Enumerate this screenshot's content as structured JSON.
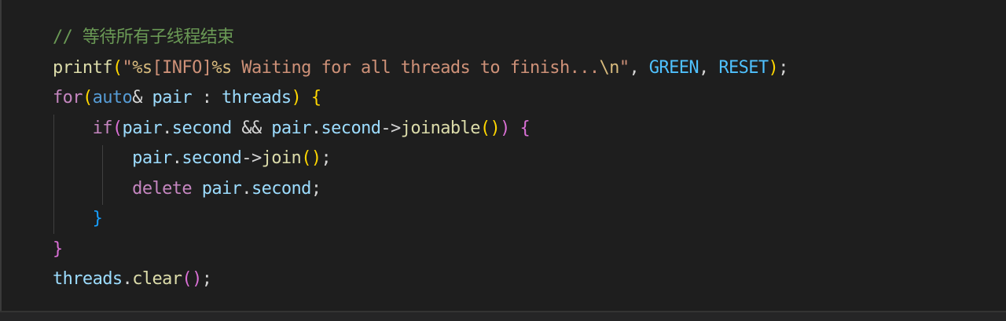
{
  "editor": {
    "lines": [
      {
        "indent": 0,
        "tokens": [
          {
            "t": "// 等待所有子线程结束",
            "c": "t-comment"
          }
        ]
      },
      {
        "indent": 0,
        "tokens": [
          {
            "t": "printf",
            "c": "t-func"
          },
          {
            "t": "(",
            "c": "t-brace1"
          },
          {
            "t": "\"",
            "c": "t-string"
          },
          {
            "t": "%s",
            "c": "t-escape"
          },
          {
            "t": "[INFO]",
            "c": "t-string"
          },
          {
            "t": "%s",
            "c": "t-escape"
          },
          {
            "t": " Waiting for all threads to finish...",
            "c": "t-string"
          },
          {
            "t": "\\n",
            "c": "t-escape"
          },
          {
            "t": "\"",
            "c": "t-string"
          },
          {
            "t": ", ",
            "c": "t-plain"
          },
          {
            "t": "GREEN",
            "c": "t-const"
          },
          {
            "t": ", ",
            "c": "t-plain"
          },
          {
            "t": "RESET",
            "c": "t-const"
          },
          {
            "t": ")",
            "c": "t-brace1"
          },
          {
            "t": ";",
            "c": "t-plain"
          }
        ]
      },
      {
        "indent": 0,
        "tokens": [
          {
            "t": "for",
            "c": "t-keyword"
          },
          {
            "t": "(",
            "c": "t-brace1"
          },
          {
            "t": "auto",
            "c": "t-type"
          },
          {
            "t": "& ",
            "c": "t-plain"
          },
          {
            "t": "pair",
            "c": "t-var"
          },
          {
            "t": " : ",
            "c": "t-plain"
          },
          {
            "t": "threads",
            "c": "t-var"
          },
          {
            "t": ")",
            "c": "t-brace1"
          },
          {
            "t": " ",
            "c": "t-plain"
          },
          {
            "t": "{",
            "c": "t-brace1"
          }
        ]
      },
      {
        "indent": 1,
        "tokens": [
          {
            "t": "if",
            "c": "t-keyword"
          },
          {
            "t": "(",
            "c": "t-brace2"
          },
          {
            "t": "pair",
            "c": "t-var"
          },
          {
            "t": ".",
            "c": "t-plain"
          },
          {
            "t": "second",
            "c": "t-var"
          },
          {
            "t": " && ",
            "c": "t-plain"
          },
          {
            "t": "pair",
            "c": "t-var"
          },
          {
            "t": ".",
            "c": "t-plain"
          },
          {
            "t": "second",
            "c": "t-var"
          },
          {
            "t": "->",
            "c": "t-plain"
          },
          {
            "t": "joinable",
            "c": "t-func"
          },
          {
            "t": "()",
            "c": "t-brace1"
          },
          {
            "t": ")",
            "c": "t-brace2"
          },
          {
            "t": " ",
            "c": "t-plain"
          },
          {
            "t": "{",
            "c": "t-brace2"
          }
        ]
      },
      {
        "indent": 2,
        "tokens": [
          {
            "t": "pair",
            "c": "t-var"
          },
          {
            "t": ".",
            "c": "t-plain"
          },
          {
            "t": "second",
            "c": "t-var"
          },
          {
            "t": "->",
            "c": "t-plain"
          },
          {
            "t": "join",
            "c": "t-func"
          },
          {
            "t": "()",
            "c": "t-brace1"
          },
          {
            "t": ";",
            "c": "t-plain"
          }
        ]
      },
      {
        "indent": 2,
        "tokens": [
          {
            "t": "delete",
            "c": "t-keyword"
          },
          {
            "t": " ",
            "c": "t-plain"
          },
          {
            "t": "pair",
            "c": "t-var"
          },
          {
            "t": ".",
            "c": "t-plain"
          },
          {
            "t": "second",
            "c": "t-var"
          },
          {
            "t": ";",
            "c": "t-plain"
          }
        ]
      },
      {
        "indent": 1,
        "tokens": [
          {
            "t": "}",
            "c": "t-brace3"
          }
        ]
      },
      {
        "indent": 0,
        "tokens": [
          {
            "t": "}",
            "c": "t-brace2"
          }
        ]
      },
      {
        "indent": 0,
        "tokens": [
          {
            "t": "threads",
            "c": "t-var"
          },
          {
            "t": ".",
            "c": "t-plain"
          },
          {
            "t": "clear",
            "c": "t-func"
          },
          {
            "t": "()",
            "c": "t-brace2"
          },
          {
            "t": ";",
            "c": "t-plain"
          }
        ]
      }
    ]
  }
}
